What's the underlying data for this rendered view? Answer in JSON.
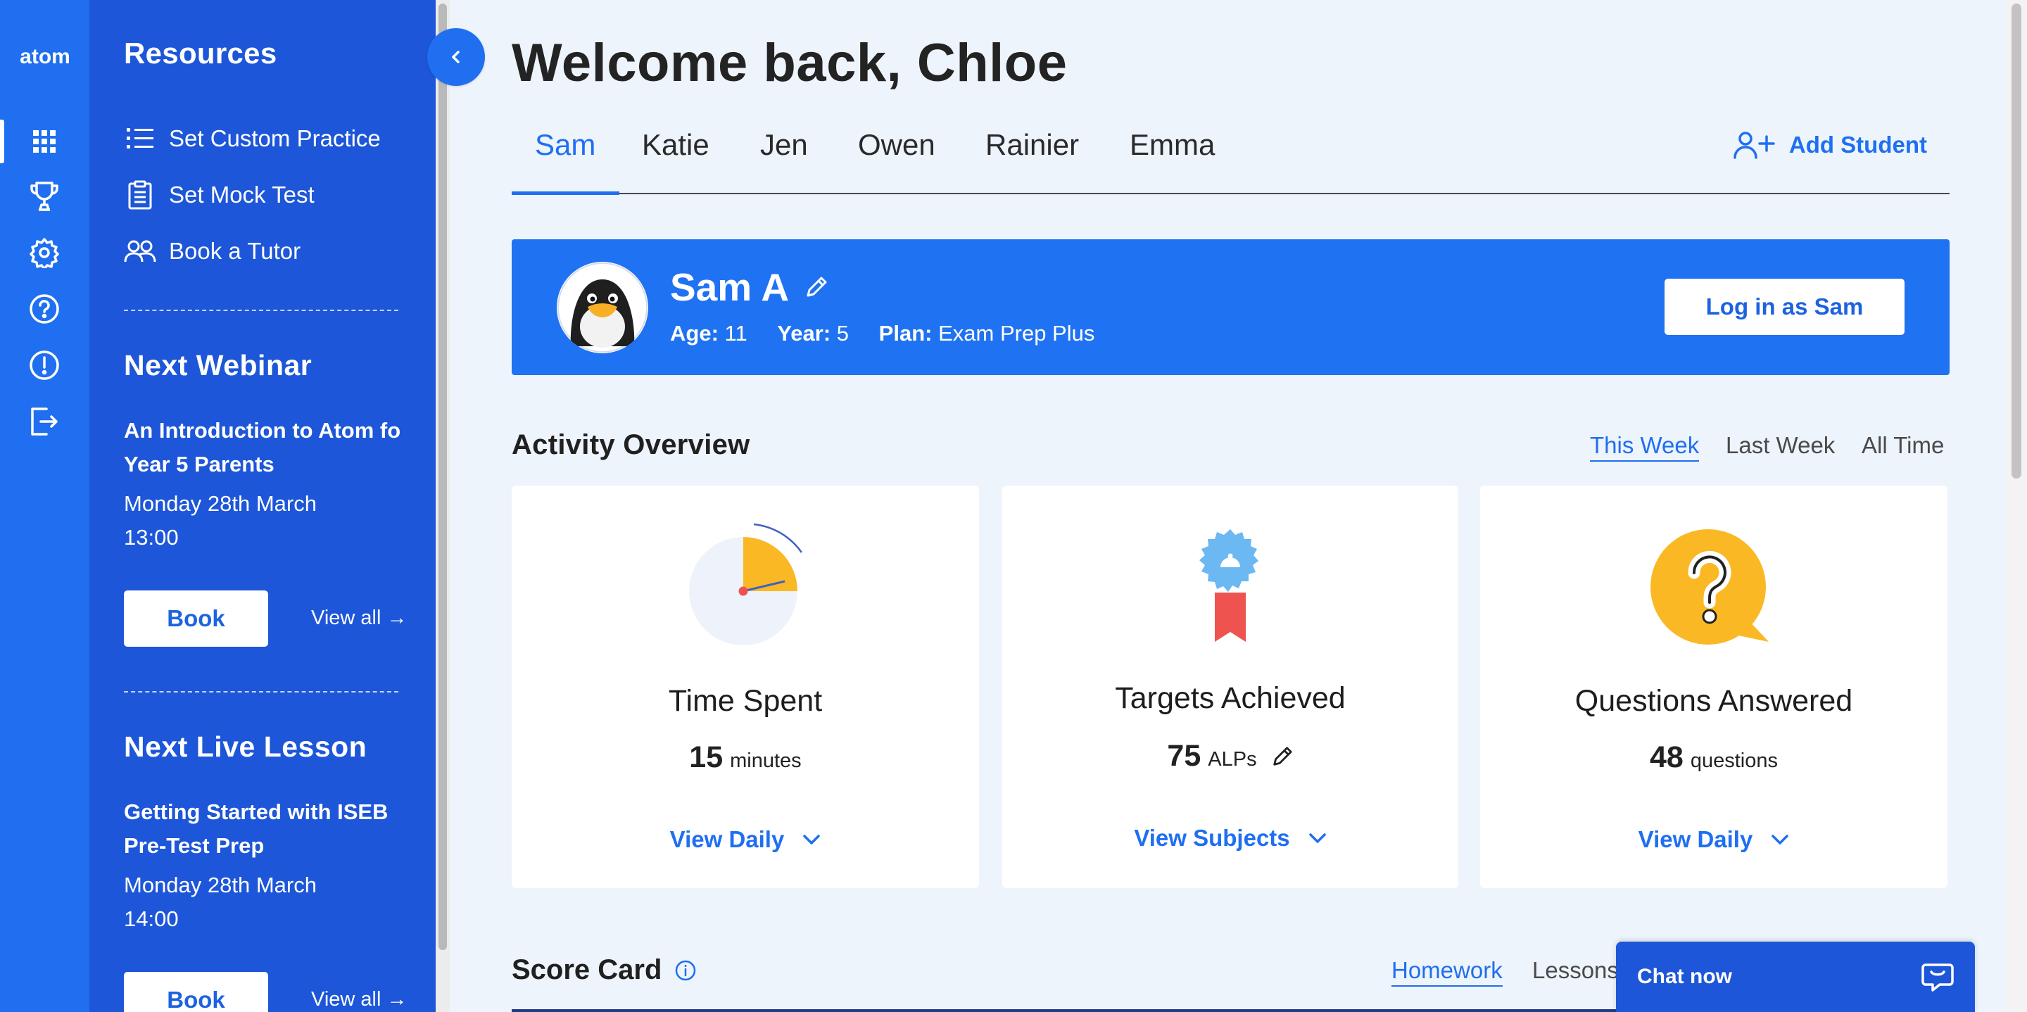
{
  "rail": {
    "logo_text": "atom",
    "icons": [
      "grid-icon",
      "trophy-icon",
      "gear-icon",
      "help-icon",
      "alert-icon",
      "logout-icon"
    ]
  },
  "resources": {
    "title": "Resources",
    "items": [
      {
        "label": "Set Custom Practice",
        "icon": "list-icon"
      },
      {
        "label": "Set Mock Test",
        "icon": "clipboard-icon"
      },
      {
        "label": "Book a Tutor",
        "icon": "people-icon"
      }
    ]
  },
  "webinar": {
    "section_title": "Next Webinar",
    "title_line1": "An Introduction to Atom for",
    "title_line2": "Year 5 Parents",
    "date": "Monday 28th March",
    "time": "13:00",
    "book_label": "Book",
    "view_all_label": "View all →"
  },
  "live_lesson": {
    "section_title": "Next Live Lesson",
    "title_line1": "Getting Started with ISEB",
    "title_line2": "Pre-Test Prep",
    "date": "Monday 28th March",
    "time": "14:00",
    "book_label": "Book",
    "view_all_label": "View all →"
  },
  "header": {
    "welcome": "Welcome back, Chloe"
  },
  "tabs": {
    "students": [
      "Sam",
      "Katie",
      "Jen",
      "Owen",
      "Rainier",
      "Emma"
    ],
    "active": "Sam",
    "add_label": "Add Student"
  },
  "student": {
    "name": "Sam A",
    "age_label": "Age:",
    "age": "11",
    "year_label": "Year:",
    "year": "5",
    "plan_label": "Plan:",
    "plan": "Exam Prep Plus",
    "login_label": "Log in as Sam"
  },
  "activity": {
    "title": "Activity Overview",
    "periods": [
      "This Week",
      "Last Week",
      "All Time"
    ],
    "active_period": "This Week",
    "cards": [
      {
        "title": "Time Spent",
        "value": "15",
        "unit": "minutes",
        "link": "View Daily",
        "icon": "clock-icon"
      },
      {
        "title": "Targets Achieved",
        "value": "75",
        "unit": "ALPs",
        "link": "View Subjects",
        "icon": "award-ribbon-icon"
      },
      {
        "title": "Questions Answered",
        "value": "48",
        "unit": "questions",
        "link": "View Daily",
        "icon": "question-bubble-icon"
      }
    ]
  },
  "score_card": {
    "title": "Score Card",
    "tabs": [
      "Homework",
      "Lessons"
    ],
    "active_tab": "Homework"
  },
  "chat": {
    "label": "Chat now"
  },
  "colors": {
    "primary": "#1f6ff0",
    "panel": "#1d56d8",
    "accent_yellow": "#fbb825",
    "background": "#eef4fc"
  }
}
